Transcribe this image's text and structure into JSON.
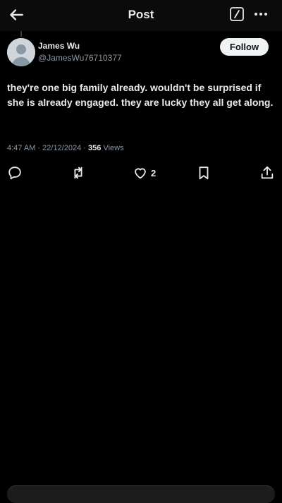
{
  "header": {
    "title": "Post"
  },
  "post": {
    "author_name": "James Wu",
    "author_handle": "@JamesWu76710377",
    "follow_label": "Follow",
    "text": "they're one big family already. wouldn't be surprised if she is already engaged. they are lucky they all get along.",
    "time": "4:47 AM",
    "date": "22/12/2024",
    "separator": "·",
    "views_count": "356",
    "views_label": "Views"
  },
  "actions": {
    "like_count": "2"
  },
  "icons": {
    "back": "back-arrow-icon",
    "edit": "compose-icon",
    "more": "more-dots-icon",
    "reply": "reply-icon",
    "repost": "repost-icon",
    "like": "heart-icon",
    "bookmark": "bookmark-icon",
    "share": "share-icon"
  },
  "colors": {
    "background": "#000000",
    "text": "#e7e9ea",
    "muted": "#8b98a5",
    "button": "#eff3f4"
  }
}
